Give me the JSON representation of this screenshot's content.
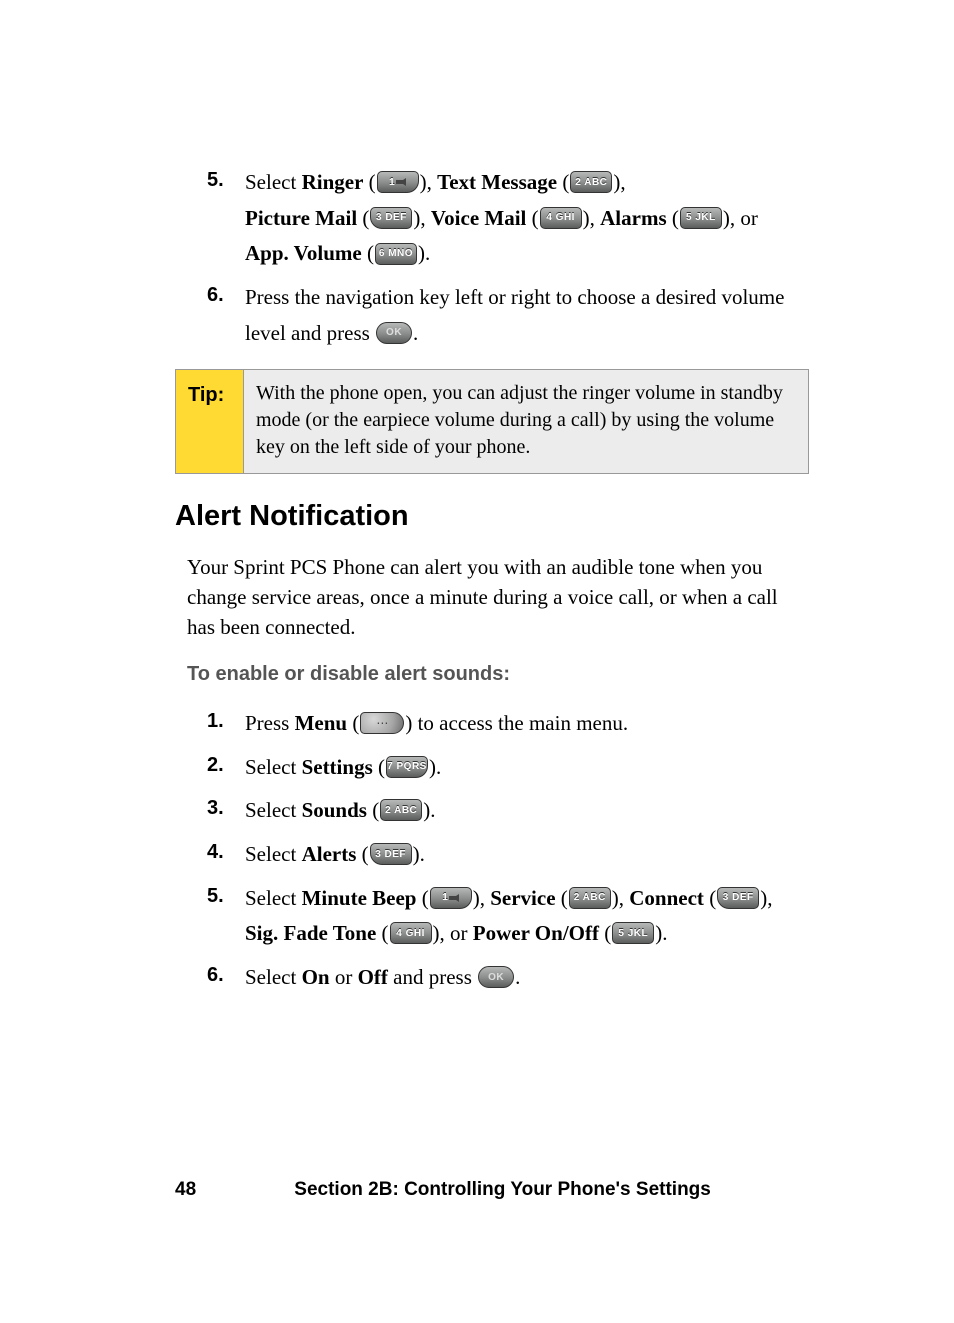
{
  "steps_a": {
    "s5": {
      "num": "5.",
      "t1": "Select ",
      "ringer": "Ringer",
      "paren_o": " (",
      "paren_c": ")",
      "comma": ", ",
      "text_message": "Text Message",
      "picture_mail": "Picture Mail",
      "voice_mail": "Voice Mail",
      "alarms": "Alarms",
      "or": ", or",
      "app_volume": "App. Volume",
      "period": "."
    },
    "s6": {
      "num": "6.",
      "text_before": "Press the navigation key left or right to choose a desired volume level and press ",
      "period": "."
    }
  },
  "keys": {
    "k1": "1",
    "k1_sub": "",
    "k2": "2 ABC",
    "k3": "3 DEF",
    "k4": "4 GHI",
    "k5": "5 JKL",
    "k6": "6 MNO",
    "k7": "7 PQRS",
    "ok": "OK"
  },
  "tip": {
    "label": "Tip:",
    "body": "With the phone open, you can adjust the ringer volume in standby mode (or the earpiece volume during a call) by using the volume key on the left side of your phone."
  },
  "heading": "Alert Notification",
  "para": "Your Sprint PCS Phone can alert you with an audible tone when you change service areas, once a minute during a voice call, or when a call has been connected.",
  "sub_heading": "To enable or disable alert sounds:",
  "steps_b": {
    "s1": {
      "num": "1.",
      "press": "Press ",
      "menu": "Menu",
      "after": " to access the main menu."
    },
    "s2": {
      "num": "2.",
      "select": "Select ",
      "settings": "Settings"
    },
    "s3": {
      "num": "3.",
      "select": "Select ",
      "sounds": "Sounds"
    },
    "s4": {
      "num": "4.",
      "select": "Select ",
      "alerts": "Alerts"
    },
    "s5": {
      "num": "5.",
      "select": "Select ",
      "minute_beep": "Minute Beep",
      "service": "Service",
      "connect": "Connect",
      "sig_fade": "Sig. Fade Tone",
      "or": ", or ",
      "power": "Power On/Off"
    },
    "s6": {
      "num": "6.",
      "select": "Select ",
      "on": "On",
      "or": " or ",
      "off": "Off",
      "and_press": " and press "
    }
  },
  "paren_o": " (",
  "paren_c": ")",
  "comma": ", ",
  "period": ".",
  "footer": {
    "page": "48",
    "section": "Section 2B: Controlling Your Phone's Settings"
  }
}
